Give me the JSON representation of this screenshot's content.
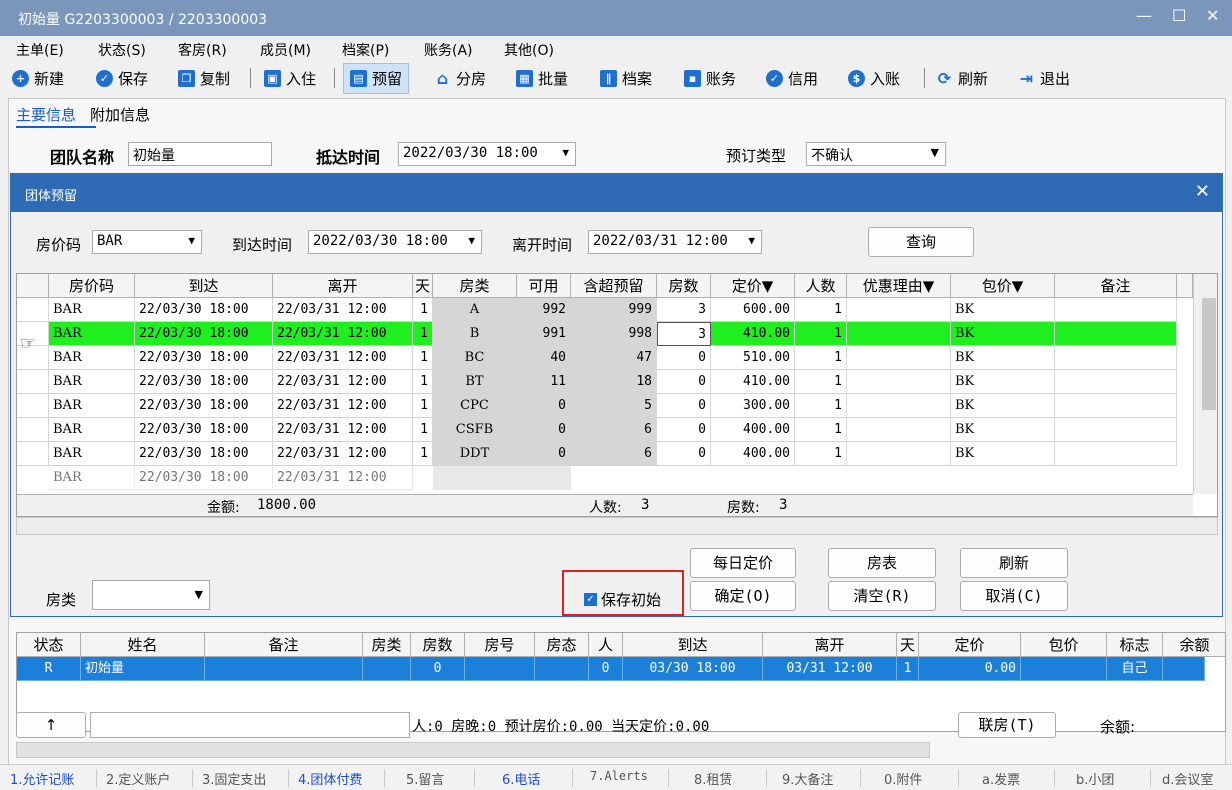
{
  "window": {
    "title": "初始量 G2203300003 / 2203300003"
  },
  "menu": [
    "主单(E)",
    "状态(S)",
    "客房(R)",
    "成员(M)",
    "档案(P)",
    "账务(A)",
    "其他(O)"
  ],
  "toolbar": {
    "new": "新建",
    "save": "保存",
    "copy": "复制",
    "checkin": "入住",
    "reserve": "预留",
    "assign": "分房",
    "batch": "批量",
    "profile": "档案",
    "account": "账务",
    "credit": "信用",
    "post": "入账",
    "refresh": "刷新",
    "exit": "退出"
  },
  "form": {
    "tab_main": "主要信息",
    "tab_extra": "附加信息",
    "group_label": "团队名称",
    "group_value": "初始量",
    "arrive_label": "抵达时间",
    "arrive_value": "2022/03/30 18:00",
    "type_label": "预订类型",
    "type_value": "不确认"
  },
  "dialog": {
    "title": "团体预留",
    "rate_code_label": "房价码",
    "rate_code_value": "BAR",
    "arrive_label": "到达时间",
    "arrive_value": "2022/03/30 18:00",
    "depart_label": "离开时间",
    "depart_value": "2022/03/31 12:00",
    "query_button": "查询",
    "columns": [
      "房价码",
      "到达",
      "离开",
      "天",
      "房类",
      "可用",
      "含超预留",
      "房数",
      "定价▼",
      "人数",
      "优惠理由▼",
      "包价▼",
      "备注"
    ],
    "rows": [
      {
        "code": "BAR",
        "arrive": "22/03/30 18:00",
        "depart": "22/03/31 12:00",
        "days": "1",
        "type": "A",
        "avail": "992",
        "over": "999",
        "rooms": "3",
        "rate": "600.00",
        "persons": "1",
        "reason": "",
        "pkg": "BK",
        "note": ""
      },
      {
        "code": "BAR",
        "arrive": "22/03/30 18:00",
        "depart": "22/03/31 12:00",
        "days": "1",
        "type": "B",
        "avail": "991",
        "over": "998",
        "rooms": "3",
        "rate": "410.00",
        "persons": "1",
        "reason": "",
        "pkg": "BK",
        "note": ""
      },
      {
        "code": "BAR",
        "arrive": "22/03/30 18:00",
        "depart": "22/03/31 12:00",
        "days": "1",
        "type": "BC",
        "avail": "40",
        "over": "47",
        "rooms": "0",
        "rate": "510.00",
        "persons": "1",
        "reason": "",
        "pkg": "BK",
        "note": ""
      },
      {
        "code": "BAR",
        "arrive": "22/03/30 18:00",
        "depart": "22/03/31 12:00",
        "days": "1",
        "type": "BT",
        "avail": "11",
        "over": "18",
        "rooms": "0",
        "rate": "410.00",
        "persons": "1",
        "reason": "",
        "pkg": "BK",
        "note": ""
      },
      {
        "code": "BAR",
        "arrive": "22/03/30 18:00",
        "depart": "22/03/31 12:00",
        "days": "1",
        "type": "CPC",
        "avail": "0",
        "over": "5",
        "rooms": "0",
        "rate": "300.00",
        "persons": "1",
        "reason": "",
        "pkg": "BK",
        "note": ""
      },
      {
        "code": "BAR",
        "arrive": "22/03/30 18:00",
        "depart": "22/03/31 12:00",
        "days": "1",
        "type": "CSFB",
        "avail": "0",
        "over": "6",
        "rooms": "0",
        "rate": "400.00",
        "persons": "1",
        "reason": "",
        "pkg": "BK",
        "note": ""
      },
      {
        "code": "BAR",
        "arrive": "22/03/30 18:00",
        "depart": "22/03/31 12:00",
        "days": "1",
        "type": "DDT",
        "avail": "0",
        "over": "6",
        "rooms": "0",
        "rate": "400.00",
        "persons": "1",
        "reason": "",
        "pkg": "BK",
        "note": ""
      }
    ],
    "total_amount_label": "金额:",
    "total_amount": "1800.00",
    "total_persons_label": "人数:",
    "total_persons": "3",
    "total_rooms_label": "房数:",
    "total_rooms": "3",
    "room_type_label": "房类",
    "save_initial_label": "保存初始",
    "daily_rate_button": "每日定价",
    "room_table_button": "房表",
    "refresh_button": "刷新",
    "ok_button": "确定(O)",
    "clear_button": "清空(R)",
    "cancel_button": "取消(C)"
  },
  "lower": {
    "columns": [
      "状态",
      "姓名",
      "备注",
      "房类",
      "房数",
      "房号",
      "房态",
      "人",
      "到达",
      "离开",
      "天",
      "定价",
      "包价",
      "标志",
      "余额"
    ],
    "row": {
      "status": "R",
      "name": "初始量",
      "note": "",
      "rtype": "",
      "rooms": "0",
      "roomno": "",
      "rstate": "",
      "persons": "0",
      "arrive": "03/30 18:00",
      "depart": "03/31 12:00",
      "days": "1",
      "rate": "0.00",
      "pkg": "",
      "flag": "自己",
      "balance": ""
    },
    "up_button": "↑",
    "summary": "人:0  房晚:0  预计房价:0.00  当天定价:0.00",
    "link_button": "联房(T)",
    "balance_label": "余额:"
  },
  "statusbar": [
    "1.允许记账",
    "2.定义账户",
    "3.固定支出",
    "4.团体付费",
    "5.留言",
    "6.电话",
    "7.Alerts",
    "8.租赁",
    "9.大备注",
    "0.附件",
    "a.发票",
    "b.小团",
    "d.会议室"
  ]
}
